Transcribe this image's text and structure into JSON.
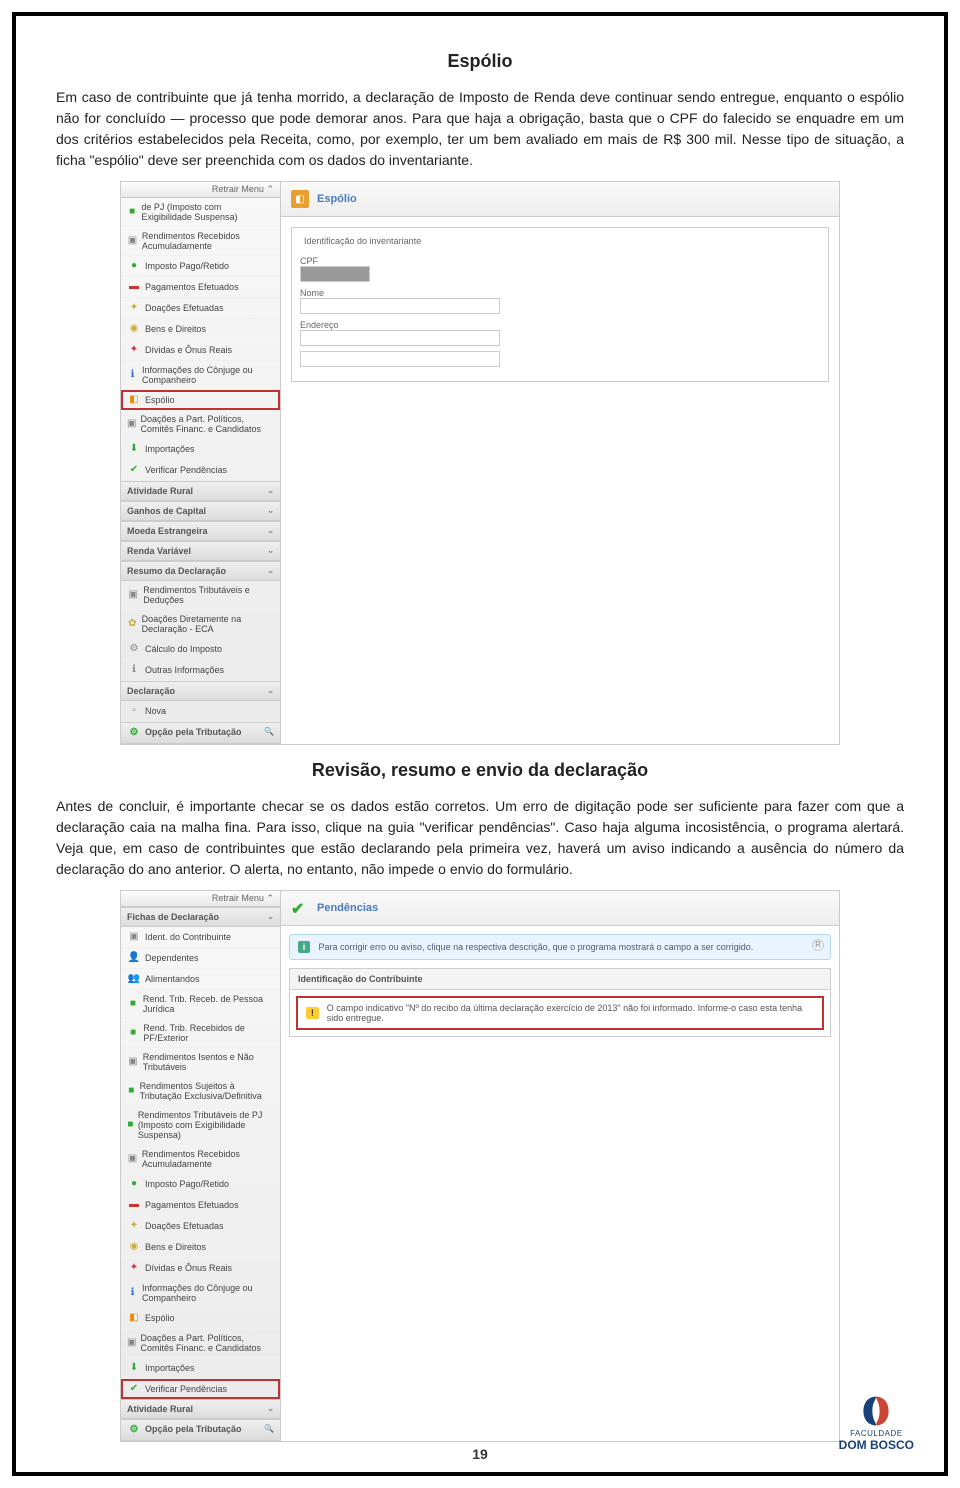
{
  "section1": {
    "title": "Espólio",
    "paragraph": "Em caso de contribuinte que já tenha morrido, a declaração de Imposto de Renda deve continuar sendo entregue, enquanto o espólio não for concluído — processo que pode demorar anos. Para que haja a obrigação, basta que o CPF do falecido se enquadre em um dos critérios estabelecidos pela Receita, como, por exemplo, ter um bem avaliado em mais de R$ 300 mil. Nesse tipo de situação, a ficha \"espólio\" deve ser preenchida com os dados do inventariante."
  },
  "app1": {
    "retrair_menu": "Retrair Menu",
    "header_title": "Espólio",
    "fieldset_title": "Identificação do inventariante",
    "fields": {
      "cpf": "CPF",
      "nome": "Nome",
      "endereco": "Endereço"
    },
    "sidebar_items_top": [
      {
        "label": "de PJ (Imposto com Exigibilidade Suspensa)",
        "icon": "■",
        "cls": "icon-green"
      },
      {
        "label": "Rendimentos Recebidos Acumuladamente",
        "icon": "▣",
        "cls": "icon-gray"
      },
      {
        "label": "Imposto Pago/Retido",
        "icon": "●",
        "cls": "icon-green"
      },
      {
        "label": "Pagamentos Efetuados",
        "icon": "▬",
        "cls": "icon-red"
      },
      {
        "label": "Doações Efetuadas",
        "icon": "✦",
        "cls": "icon-yellow"
      },
      {
        "label": "Bens e Direitos",
        "icon": "◉",
        "cls": "icon-yellow"
      },
      {
        "label": "Dívidas e Ônus Reais",
        "icon": "✦",
        "cls": "icon-red"
      },
      {
        "label": "Informações do Cônjuge ou Companheiro",
        "icon": "ℹ",
        "cls": "icon-blue"
      },
      {
        "label": "Espólio",
        "icon": "◧",
        "cls": "icon-orange",
        "selected": true
      },
      {
        "label": "Doações a Part. Políticos, Comitês Financ. e Candidatos",
        "icon": "▣",
        "cls": "icon-gray"
      },
      {
        "label": "Importações",
        "icon": "⬇",
        "cls": "icon-green"
      },
      {
        "label": "Verificar Pendências",
        "icon": "✔",
        "cls": "icon-green"
      }
    ],
    "side_sections": [
      {
        "label": "Atividade Rural"
      },
      {
        "label": "Ganhos de Capital"
      },
      {
        "label": "Moeda Estrangeira"
      },
      {
        "label": "Renda Variável"
      },
      {
        "label": "Resumo da Declaração"
      }
    ],
    "resumo_items": [
      {
        "label": "Rendimentos Tributáveis e Deduções",
        "icon": "▣",
        "cls": "icon-gray"
      },
      {
        "label": "Doações Diretamente na Declaração - ECA",
        "icon": "✿",
        "cls": "icon-yellow"
      },
      {
        "label": "Cálculo do Imposto",
        "icon": "⚙",
        "cls": "icon-gray"
      },
      {
        "label": "Outras Informações",
        "icon": "ℹ",
        "cls": "icon-gray"
      }
    ],
    "declaracao": "Declaração",
    "nova": "Nova",
    "opcao": "Opção pela Tributação"
  },
  "section2": {
    "title": "Revisão, resumo e envio da declaração",
    "paragraph": "Antes de concluir, é importante checar se os dados estão corretos. Um erro de digitação pode ser suficiente para fazer com que a declaração caia na malha fina. Para isso, clique na guia \"verificar pendências\". Caso haja alguma incosistência, o programa alertará. Veja que, em caso de contribuintes que estão declarando pela primeira vez, haverá um aviso indicando a ausência do número da declaração do ano anterior. O alerta, no entanto, não impede o envio do formulário."
  },
  "app2": {
    "retrair_menu": "Retrair Menu",
    "header_title": "Pendências",
    "fichas": "Fichas de Declaração",
    "info_text": "Para corrigir erro ou aviso, clique na respectiva descrição, que o programa mostrará o campo a ser corrigido.",
    "pend_header": "Identificação do Contribuinte",
    "pend_text": "O campo indicativo \"Nº do recibo da última declaração exercício de 2013\" não foi informado. Informe-o caso esta tenha sido entregue.",
    "sidebar_items": [
      {
        "label": "Ident. do Contribuinte",
        "icon": "▣",
        "cls": "icon-gray"
      },
      {
        "label": "Dependentes",
        "icon": "👤",
        "cls": "icon-blue"
      },
      {
        "label": "Alimentandos",
        "icon": "👥",
        "cls": "icon-orange"
      },
      {
        "label": "Rend. Trib. Receb. de Pessoa Jurídica",
        "icon": "■",
        "cls": "icon-green"
      },
      {
        "label": "Rend. Trib. Recebidos de PF/Exterior",
        "icon": "■",
        "cls": "icon-green"
      },
      {
        "label": "Rendimentos Isentos e Não Tributáveis",
        "icon": "▣",
        "cls": "icon-gray"
      },
      {
        "label": "Rendimentos Sujeitos à Tributação Exclusiva/Definitiva",
        "icon": "■",
        "cls": "icon-green"
      },
      {
        "label": "Rendimentos Tributáveis de PJ (Imposto com Exigibilidade Suspensa)",
        "icon": "■",
        "cls": "icon-green"
      },
      {
        "label": "Rendimentos Recebidos Acumuladamente",
        "icon": "▣",
        "cls": "icon-gray"
      },
      {
        "label": "Imposto Pago/Retido",
        "icon": "●",
        "cls": "icon-green"
      },
      {
        "label": "Pagamentos Efetuados",
        "icon": "▬",
        "cls": "icon-red"
      },
      {
        "label": "Doações Efetuadas",
        "icon": "✦",
        "cls": "icon-yellow"
      },
      {
        "label": "Bens e Direitos",
        "icon": "◉",
        "cls": "icon-yellow"
      },
      {
        "label": "Dívidas e Ônus Reais",
        "icon": "✦",
        "cls": "icon-red"
      },
      {
        "label": "Informações do Cônjuge ou Companheiro",
        "icon": "ℹ",
        "cls": "icon-blue"
      },
      {
        "label": "Espólio",
        "icon": "◧",
        "cls": "icon-orange"
      },
      {
        "label": "Doações a Part. Políticos, Comitês Financ. e Candidatos",
        "icon": "▣",
        "cls": "icon-gray"
      },
      {
        "label": "Importações",
        "icon": "⬇",
        "cls": "icon-green"
      },
      {
        "label": "Verificar Pendências",
        "icon": "✔",
        "cls": "icon-green",
        "selected": true
      }
    ],
    "atividade": "Atividade Rural",
    "opcao": "Opção pela Tributação"
  },
  "page_number": "19",
  "logo": {
    "line1": "FACULDADE",
    "line2": "DOM BOSCO"
  }
}
